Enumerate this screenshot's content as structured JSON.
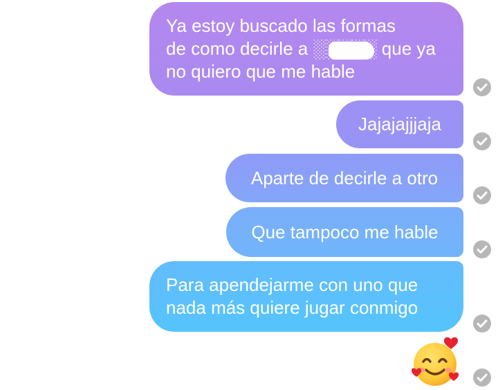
{
  "messages": [
    {
      "text": "Ya estoy buscado las formas\nde como decirle a ░░░░░ que ya\nno quiero que me hable",
      "redacted": true
    },
    {
      "text": "Jajajajjjaja"
    },
    {
      "text": "Aparte de decirle a otro"
    },
    {
      "text": "Que tampoco me hable"
    },
    {
      "text": "Para apendejarme con uno que\nnada más quiere jugar conmigo"
    },
    {
      "emoji": "smiling-face-with-hearts"
    }
  ],
  "status_icon": "check-circle-icon",
  "colors": {
    "bubble_top": "#b487ee",
    "bubble_bottom": "#55c4fd",
    "status_gray": "#b7b7b7",
    "background": "#ffffff"
  }
}
